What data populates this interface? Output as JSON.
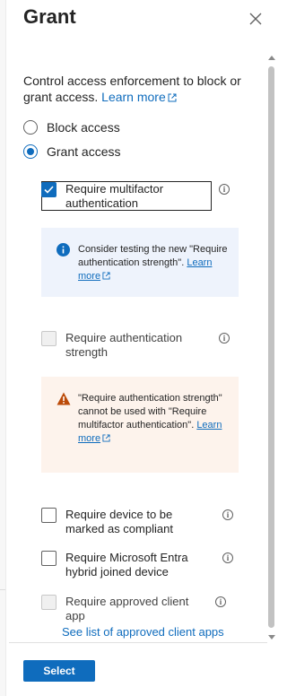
{
  "panel": {
    "title": "Grant"
  },
  "intro": {
    "text": "Control access enforcement to block or grant access.",
    "learn_more": "Learn more"
  },
  "access_options": [
    {
      "label": "Block access",
      "selected": false
    },
    {
      "label": "Grant access",
      "selected": true
    }
  ],
  "controls": [
    {
      "label": "Require multifactor authentication",
      "checked": true,
      "enabled": true
    },
    {
      "label": "Require authentication strength",
      "checked": false,
      "enabled": false
    },
    {
      "label": "Require device to be marked as compliant",
      "checked": false,
      "enabled": true
    },
    {
      "label": "Require Microsoft Entra hybrid joined device",
      "checked": false,
      "enabled": true
    },
    {
      "label": "Require approved client app",
      "checked": false,
      "enabled": false
    }
  ],
  "info_message": {
    "text": "Consider testing the new \"Require authentication strength\".",
    "link": "Learn more"
  },
  "warning_message": {
    "text": "\"Require authentication strength\" cannot be used with \"Require multifactor authentication\".",
    "link": "Learn more"
  },
  "approved_apps_link": "See list of approved client apps",
  "footer": {
    "select_label": "Select"
  },
  "colors": {
    "accent": "#0f6cbd",
    "info_bg": "#eef3fc",
    "warning_bg": "#fdf3ec",
    "warning_icon": "#bc4b09"
  }
}
